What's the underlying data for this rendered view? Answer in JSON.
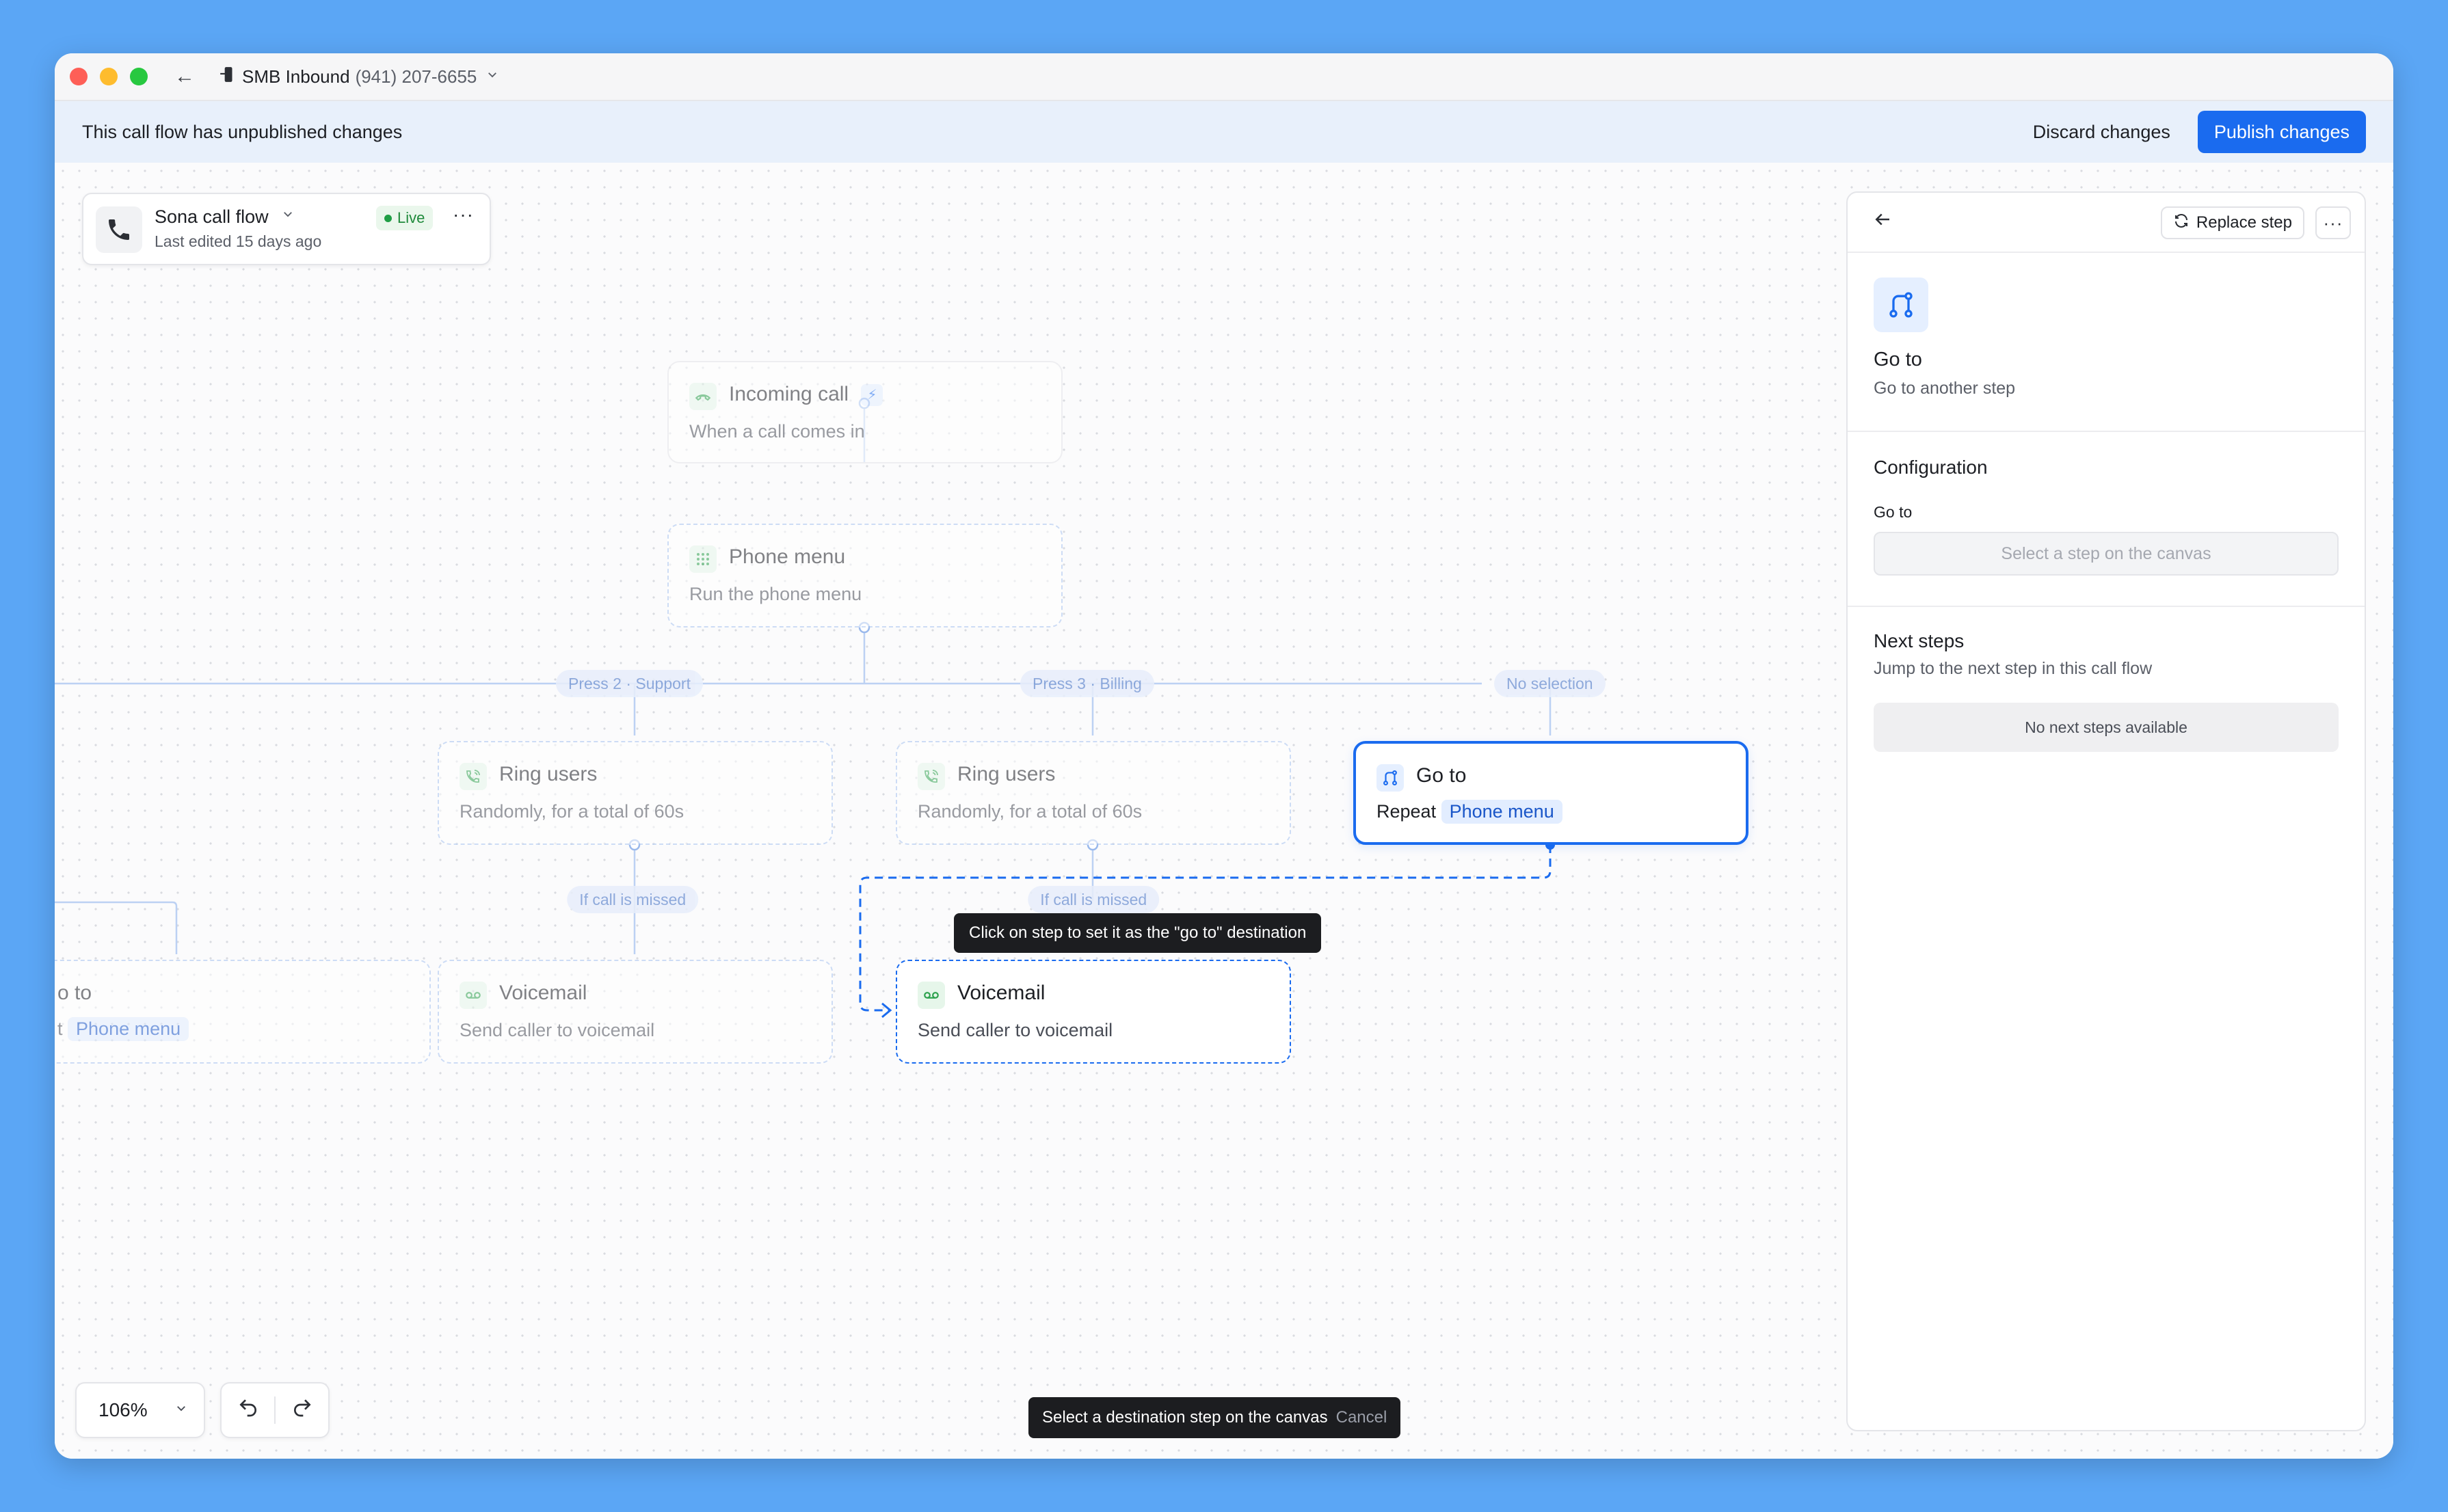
{
  "titlebar": {
    "back": "←",
    "title": "SMB Inbound",
    "number": "(941) 207-6655"
  },
  "banner": {
    "message": "This call flow has unpublished changes",
    "discard_label": "Discard changes",
    "publish_label": "Publish changes"
  },
  "flow": {
    "name": "Sona call flow",
    "status": "Live",
    "edited": "Last edited 15 days ago"
  },
  "nodes": {
    "incoming": {
      "title": "Incoming call",
      "subtitle": "When a call comes in",
      "icon": "incoming-call-icon"
    },
    "phone_menu": {
      "title": "Phone menu",
      "subtitle": "Run the phone menu",
      "icon": "grid-icon"
    },
    "ring1": {
      "title": "Ring users",
      "subtitle": "Randomly, for a total of 60s",
      "icon": "phone-ring-icon"
    },
    "ring2": {
      "title": "Ring users",
      "subtitle": "Randomly, for a total of 60s",
      "icon": "phone-ring-icon"
    },
    "goto_selected": {
      "title": "Go to",
      "prefix": "Repeat",
      "target": "Phone menu",
      "icon": "goto-icon"
    },
    "goto_left": {
      "title": "o to",
      "prefix": "t",
      "target": "Phone menu"
    },
    "voicemail1": {
      "title": "Voicemail",
      "subtitle": "Send caller to voicemail",
      "icon": "voicemail-icon"
    },
    "voicemail2": {
      "title": "Voicemail",
      "subtitle": "Send caller to voicemail",
      "icon": "voicemail-icon"
    }
  },
  "branches": {
    "press2": "Press 2 · Support",
    "press3": "Press 3 · Billing",
    "no_selection": "No selection",
    "missed1": "If call is missed",
    "missed2": "If call is missed"
  },
  "tooltip": "Click on step to set it as the \"go to\" destination",
  "controls": {
    "zoom": "106%"
  },
  "hint": {
    "text": "Select a destination step on the canvas",
    "cancel": "Cancel"
  },
  "panel": {
    "replace_label": "Replace step",
    "step_title": "Go to",
    "step_subtitle": "Go to another step",
    "config_title": "Configuration",
    "goto_label": "Go to",
    "goto_placeholder": "Select a step on the canvas",
    "next_title": "Next steps",
    "next_subtitle": "Jump to the next step in this call flow",
    "next_empty": "No next steps available"
  },
  "colors": {
    "accent": "#1a6bef",
    "live_green": "#1f9e45",
    "background": "#5ba6f5"
  }
}
